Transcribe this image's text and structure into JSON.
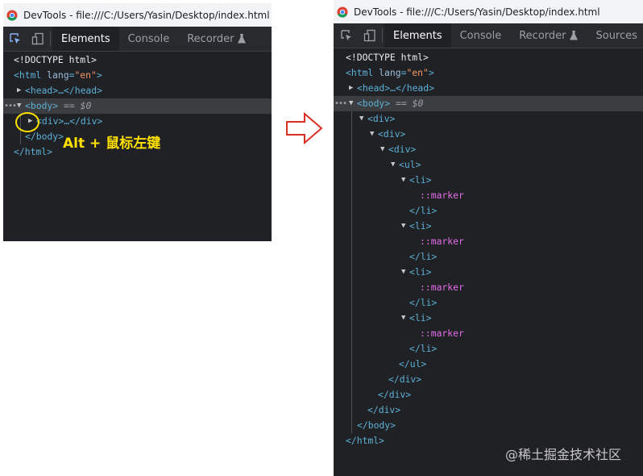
{
  "left": {
    "window_title": "DevTools - file:///C:/Users/Yasin/Desktop/index.html",
    "tabs": [
      "Elements",
      "Console",
      "Recorder"
    ],
    "active_tab": "Elements",
    "tree": {
      "doctype": "<!DOCTYPE html>",
      "html_open": "<html",
      "html_attr": "lang",
      "html_attr_value": "\"en\"",
      "html_close_bracket": ">",
      "head_collapsed": "<head>…</head>",
      "body_open": "<body>",
      "body_selected_suffix": " == $0",
      "div_collapsed": "<div>…</div>",
      "body_close": "</body>",
      "html_close": "</html>"
    },
    "annotation": "Alt + 鼠标左键"
  },
  "right": {
    "window_title": "DevTools - file:///C:/Users/Yasin/Desktop/index.html",
    "tabs": [
      "Elements",
      "Console",
      "Recorder",
      "Sources"
    ],
    "active_tab": "Elements",
    "tree": {
      "doctype": "<!DOCTYPE html>",
      "html_open": "<html",
      "html_attr": "lang",
      "html_attr_value": "\"en\"",
      "html_close_bracket": ">",
      "head_collapsed": "<head>…</head>",
      "body_open": "<body>",
      "body_selected_suffix": " == $0",
      "div_open": "<div>",
      "div_close": "</div>",
      "ul_open": "<ul>",
      "ul_close": "</ul>",
      "li_open": "<li>",
      "li_close": "</li>",
      "marker": "::marker",
      "body_close": "</body>",
      "html_close": "</html>"
    },
    "watermark": "@稀土掘金技术社区"
  },
  "colors": {
    "tag": "#5db0d7",
    "attr_name": "#9bbbdc",
    "attr_value": "#f29766",
    "pseudo": "#e36eec",
    "highlight": "#ffe100",
    "arrow": "#d93025"
  },
  "icons": [
    "chrome-icon",
    "inspect-icon",
    "device-toggle-icon",
    "flask-icon",
    "expand-arrow-icon",
    "collapse-arrow-icon",
    "right-arrow-icon"
  ]
}
